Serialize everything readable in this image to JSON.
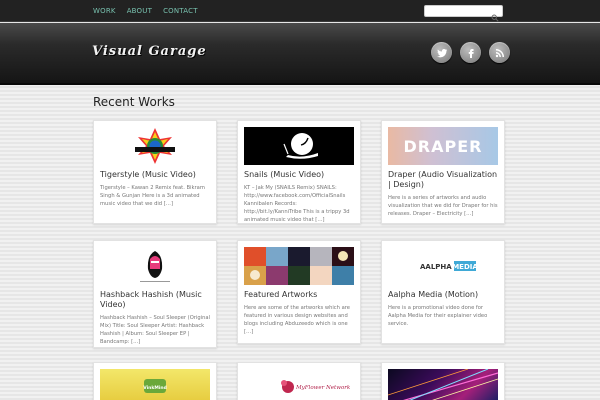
{
  "nav": {
    "items": [
      {
        "label": "WORK"
      },
      {
        "label": "ABOUT"
      },
      {
        "label": "CONTACT"
      }
    ]
  },
  "search": {
    "placeholder": "",
    "value": ""
  },
  "site": {
    "title": "Visual Garage"
  },
  "social": {
    "icons": [
      "twitter-bird-icon",
      "facebook-icon",
      "rss-icon"
    ]
  },
  "main": {
    "heading": "Recent Works",
    "cards": [
      {
        "title": "Tigerstyle (Music Video)",
        "excerpt": "Tigerstyle – Kawan 2 Remix feat. Bikram Singh & Gunjan Here is a 3d animated music video that we did […]"
      },
      {
        "title": "Snails (Music Video)",
        "excerpt": "KT – Jak My (SNAILS Remix) SNAILS: http://www.facebook.com/OfficialSnails Kannibalen Records: http://bit.ly/KanniTribe This is a trippy 3d animated music video that […]"
      },
      {
        "title": "Draper (Audio Visualization | Design)",
        "excerpt": "Here is a series of artworks and audio visualization that we did for Draper for his releases. Draper – Electricity […]"
      },
      {
        "title": "Hashback Hashish (Music Video)",
        "excerpt": "Hashback Hashish – Soul Sleeper (Original Mix) Title: Soul Sleeper Artist: Hashback Hashish | Album: Soul Sleeper EP | Bandcamp: […]"
      },
      {
        "title": "Featured Artworks",
        "excerpt": "Here are some of the artworks which are featured in various design websites and blogs including Abduzeedo which is one […]"
      },
      {
        "title": "Aalpha Media (Motion)",
        "excerpt": "Here is a promotional video done for Aalpha Media for their explainer video service."
      }
    ],
    "partial": [
      {
        "logo_text": "VinkMind"
      },
      {
        "logo_text": "MyFlower Network"
      },
      {
        "logo_text": ""
      }
    ]
  },
  "thumb_texts": {
    "draper": "DRAPER",
    "aalpha_a": "AALPHA",
    "aalpha_b": "MEDIA"
  }
}
